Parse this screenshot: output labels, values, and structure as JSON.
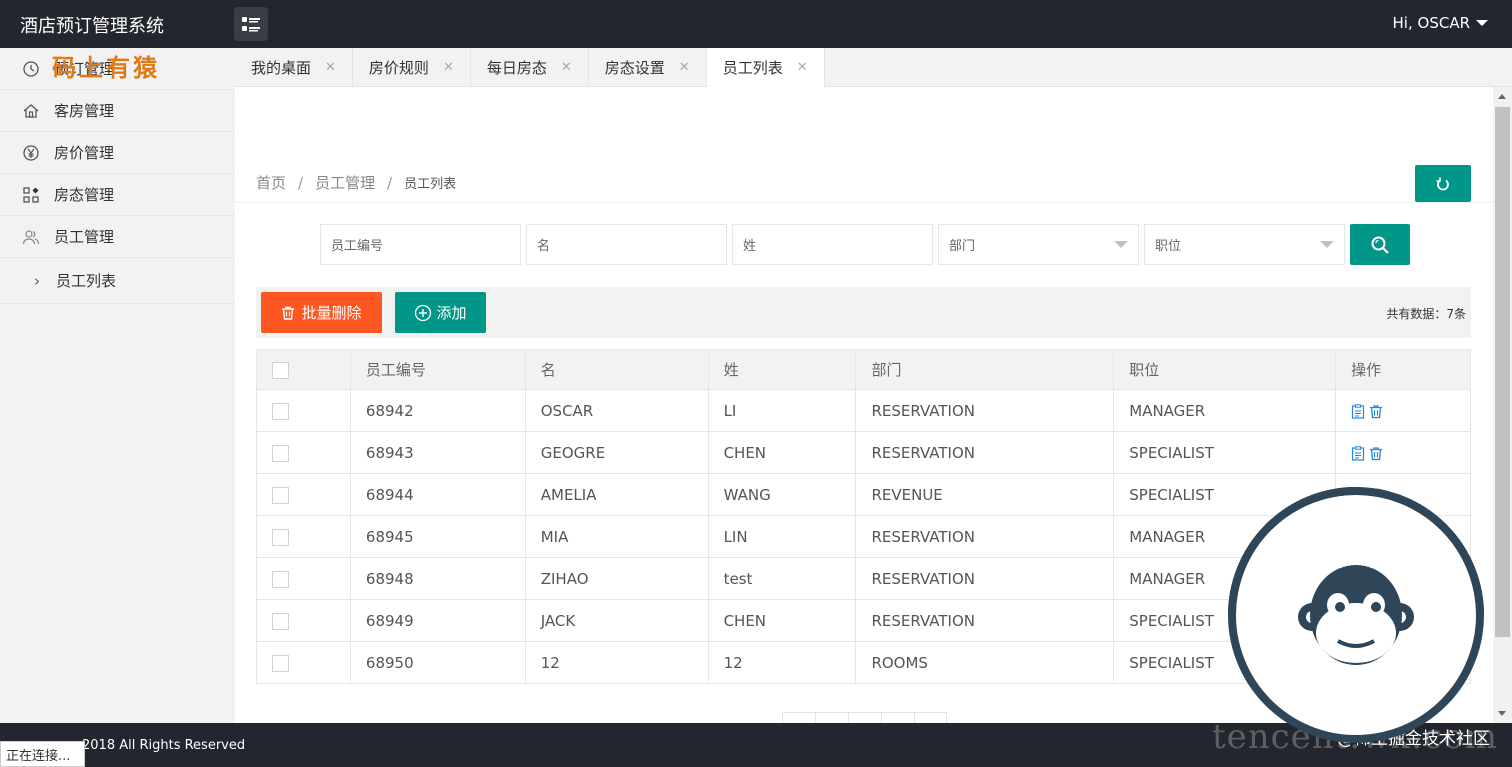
{
  "app": {
    "title": "酒店预订管理系统",
    "user": "Hi, OSCAR"
  },
  "watermark": {
    "top_left": "码上有猿",
    "bottom": "tencent.wx.com",
    "bottom_cn": "@稀土掘金技术社区"
  },
  "sidebar": {
    "items": [
      {
        "label": "预订管理",
        "icon": "clock-icon"
      },
      {
        "label": "客房管理",
        "icon": "home-icon"
      },
      {
        "label": "房价管理",
        "icon": "yen-icon"
      },
      {
        "label": "房态管理",
        "icon": "apps-icon"
      },
      {
        "label": "员工管理",
        "icon": "users-icon"
      }
    ],
    "sub_item": "员工列表"
  },
  "tabs": [
    {
      "label": "我的桌面",
      "active": false
    },
    {
      "label": "房价规则",
      "active": false
    },
    {
      "label": "每日房态",
      "active": false
    },
    {
      "label": "房态设置",
      "active": false
    },
    {
      "label": "员工列表",
      "active": true
    }
  ],
  "breadcrumb": {
    "home": "首页",
    "section": "员工管理",
    "current": "员工列表",
    "sep": "/"
  },
  "search": {
    "employee_id_placeholder": "员工编号",
    "first_name_placeholder": "名",
    "last_name_placeholder": "姓",
    "department_placeholder": "部门",
    "position_placeholder": "职位"
  },
  "toolbar": {
    "batch_delete": "批量删除",
    "add": "添加",
    "count_text": "共有数据：7条"
  },
  "table": {
    "headers": [
      "员工编号",
      "名",
      "姓",
      "部门",
      "职位",
      "操作"
    ],
    "rows": [
      [
        "68942",
        "OSCAR",
        "LI",
        "RESERVATION",
        "MANAGER"
      ],
      [
        "68943",
        "GEOGRE",
        "CHEN",
        "RESERVATION",
        "SPECIALIST"
      ],
      [
        "68944",
        "AMELIA",
        "WANG",
        "REVENUE",
        "SPECIALIST"
      ],
      [
        "68945",
        "MIA",
        "LIN",
        "RESERVATION",
        "MANAGER"
      ],
      [
        "68948",
        "ZIHAO",
        "test",
        "RESERVATION",
        "MANAGER"
      ],
      [
        "68949",
        "JACK",
        "CHEN",
        "RESERVATION",
        "SPECIALIST"
      ],
      [
        "68950",
        "12",
        "12",
        "ROOMS",
        "SPECIALIST"
      ]
    ]
  },
  "footer": {
    "copyright": "2018 All Rights Reserved",
    "status": "正在连接..."
  },
  "colors": {
    "header": "#23262e",
    "primary": "#009688",
    "danger": "#ff5722",
    "link_icon": "#1e88e5"
  }
}
